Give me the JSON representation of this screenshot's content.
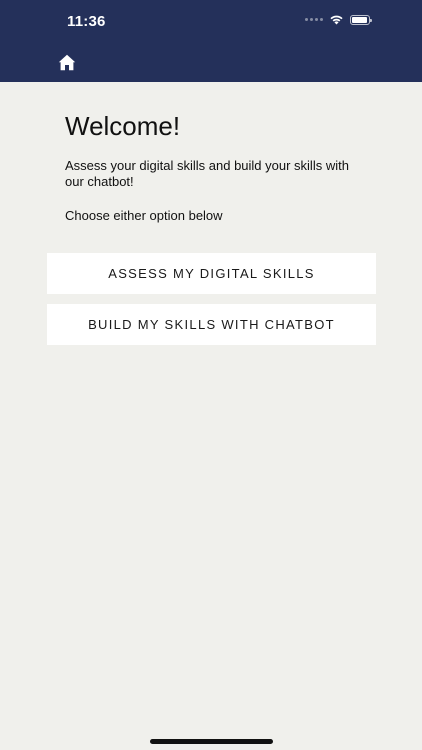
{
  "status_bar": {
    "time": "11:36",
    "icons": [
      "cellular-signal-icon",
      "wifi-icon",
      "battery-icon"
    ]
  },
  "nav": {
    "icon": "home-icon"
  },
  "main": {
    "title": "Welcome!",
    "subtitle": "Assess your digital skills and build your skills with our chatbot!",
    "instruction": "Choose either option below"
  },
  "buttons": {
    "assess_label": "ASSESS MY DIGITAL SKILLS",
    "build_label": "BUILD MY SKILLS WITH CHATBOT"
  },
  "colors": {
    "header_background": "#24305a",
    "page_background": "#f0f0ec",
    "button_background": "#ffffff",
    "text": "#111111"
  }
}
